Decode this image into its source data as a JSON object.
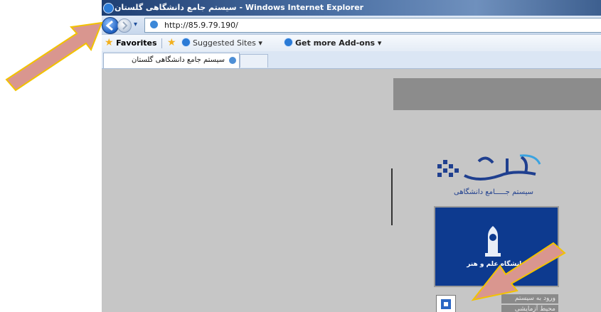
{
  "window": {
    "title": "سیستم جامع دانشگاهی گلستان - Windows Internet Explorer"
  },
  "navigation": {
    "address": "http://85.9.79.190/",
    "history_glyph": "▾"
  },
  "favorites_bar": {
    "favorites_label": "Favorites",
    "suggested_label": "Suggested Sites ▾",
    "addons_label": "Get more Add-ons ▾"
  },
  "tabs": [
    {
      "label": "سیستم جامع دانشگاهی گلستان"
    }
  ],
  "page": {
    "logo_subtitle": "سیستم جـــــامع دانشگاهی",
    "university_caption": "دانشگاه علم و هنر",
    "login_button": "ورود به سیستم",
    "test_env_button": "محیط آزمایشی"
  },
  "colors": {
    "arrow": "#d9968f",
    "arrow_outline": "#f2c200",
    "university_panel": "#0d3a8f",
    "content_bg": "#c6c6c6"
  }
}
